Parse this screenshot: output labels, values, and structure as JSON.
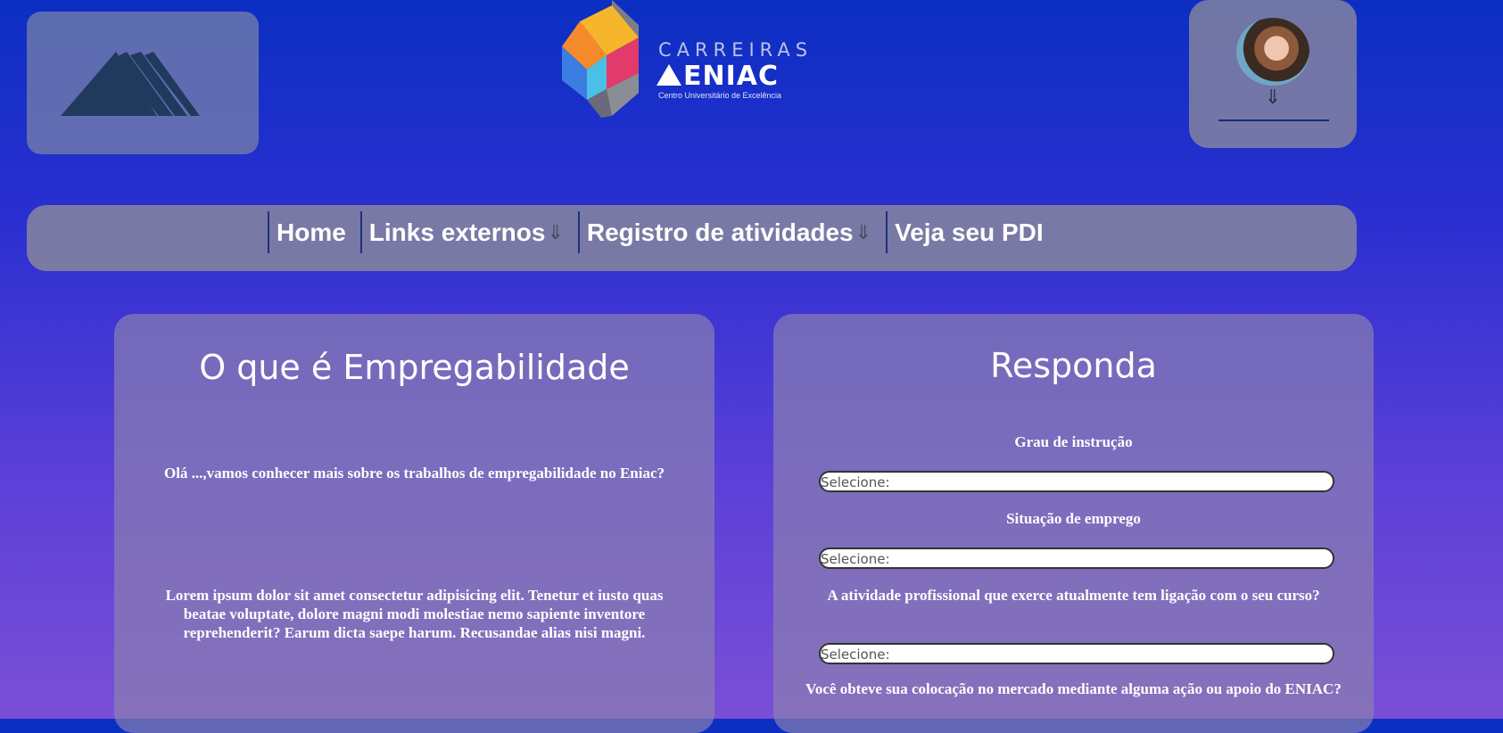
{
  "brand": {
    "line1": "CARREIRAS",
    "line2": "ENIAC",
    "tagline": "Centro Universitário de Excelência"
  },
  "profile": {
    "menu_arrow": "⇓"
  },
  "nav": {
    "items": [
      {
        "label": "Home",
        "arrow": ""
      },
      {
        "label": "Links externos",
        "arrow": "⇓"
      },
      {
        "label": "Registro de atividades",
        "arrow": "⇓"
      },
      {
        "label": "Veja seu PDI",
        "arrow": ""
      }
    ]
  },
  "left_card": {
    "title": "O que é Empregabilidade",
    "intro": "Olá ...,vamos conhecer mais sobre os trabalhos de empregabilidade no Eniac?",
    "body": "Lorem ipsum dolor sit amet consectetur adipisicing elit. Tenetur et iusto quas beatae voluptate, dolore magni modi molestiae nemo sapiente inventore reprehenderit? Earum dicta saepe harum. Recusandae alias nisi magni."
  },
  "right_card": {
    "title": "Responda",
    "questions": [
      {
        "label": "Grau de instrução",
        "placeholder": "Selecione:"
      },
      {
        "label": "Situação de emprego",
        "placeholder": "Selecione:"
      },
      {
        "label": "A atividade profissional que exerce atualmente tem ligação com o seu curso?",
        "placeholder": "Selecione:"
      },
      {
        "label": "Você obteve sua colocação no mercado mediante alguma ação ou apoio do ENIAC?"
      }
    ]
  },
  "colors": {
    "bg_top": "#0b2fc2",
    "bg_bottom": "#7a4fd6",
    "nav_divider": "#1d2f86"
  }
}
